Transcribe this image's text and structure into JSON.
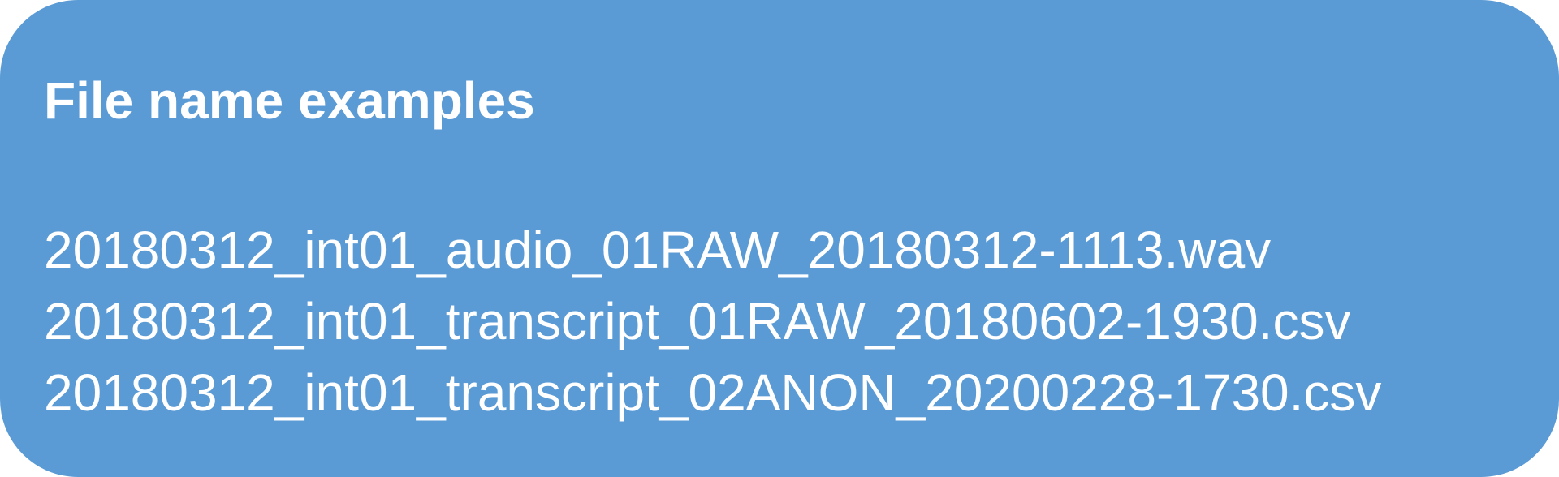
{
  "panel": {
    "title": "File name examples",
    "background_color": "#5b9bd5",
    "text_color": "#ffffff",
    "examples": [
      "20180312_int01_audio_01RAW_20180312-1113.wav",
      "20180312_int01_transcript_01RAW_20180602-1930.csv",
      "20180312_int01_transcript_02ANON_20200228-1730.csv"
    ]
  }
}
